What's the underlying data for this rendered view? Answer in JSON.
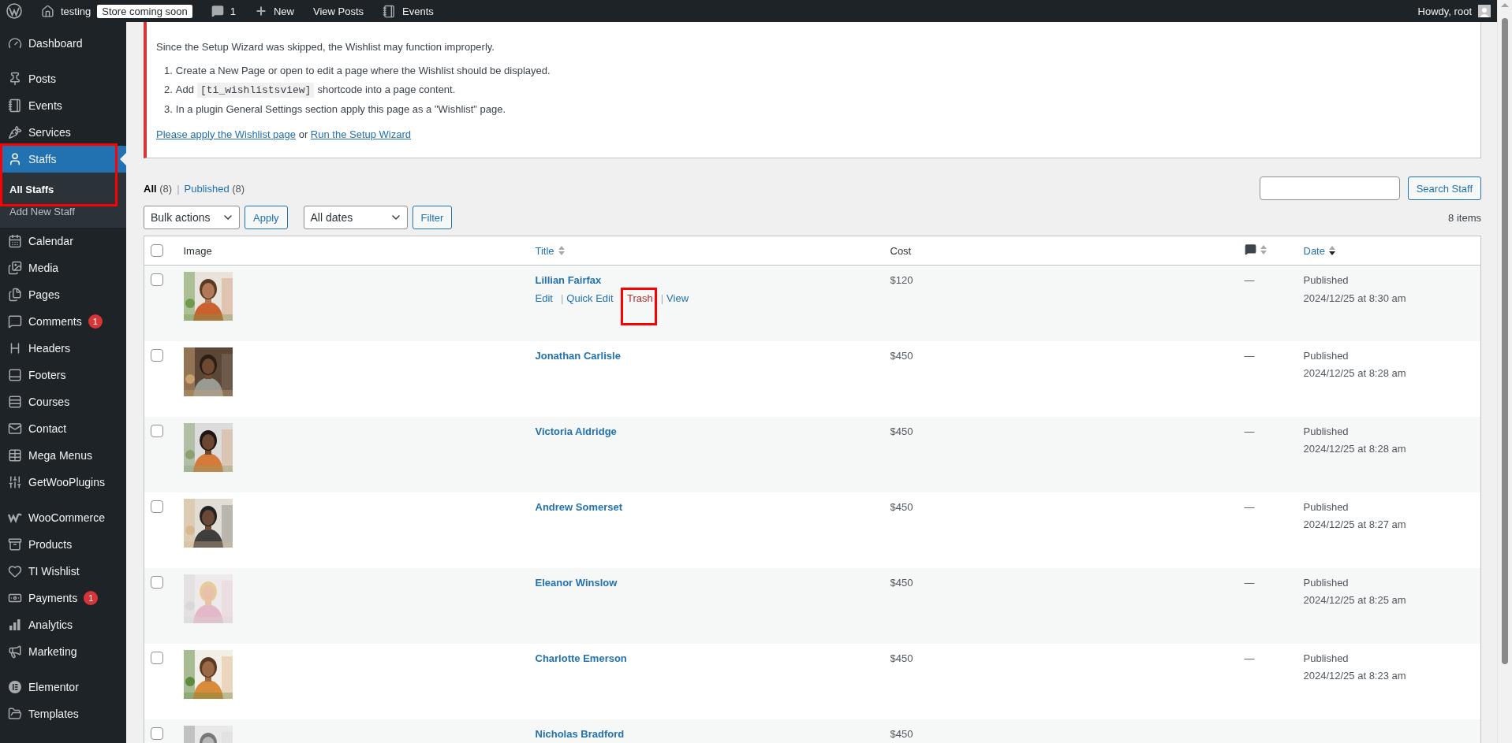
{
  "admin_bar": {
    "site": "testing",
    "badge": "Store coming soon",
    "comments_count": "1",
    "new": "New",
    "view_posts": "View Posts",
    "events": "Events",
    "greeting": "Howdy, root"
  },
  "sidebar": {
    "groups": [
      [
        {
          "label": "Dashboard",
          "selected": false,
          "highlighted": false
        }
      ],
      [
        {
          "label": "Posts",
          "selected": false,
          "highlighted": false
        },
        {
          "label": "Events",
          "selected": false,
          "highlighted": false
        },
        {
          "label": "Services",
          "selected": false,
          "highlighted": false
        },
        {
          "label": "Staffs",
          "selected": true,
          "highlighted": true,
          "children": [
            {
              "label": "All Staffs",
              "selected": true
            },
            {
              "label": "Add New Staff",
              "selected": false
            }
          ]
        },
        {
          "label": "Calendar",
          "selected": false,
          "highlighted": false
        },
        {
          "label": "Media",
          "selected": false,
          "highlighted": false
        },
        {
          "label": "Pages",
          "selected": false,
          "highlighted": false
        },
        {
          "label": "Comments",
          "selected": false,
          "highlighted": false,
          "badge": "1"
        },
        {
          "label": "Headers",
          "selected": false,
          "highlighted": false
        },
        {
          "label": "Footers",
          "selected": false,
          "highlighted": false
        },
        {
          "label": "Courses",
          "selected": false,
          "highlighted": false
        },
        {
          "label": "Contact",
          "selected": false,
          "highlighted": false
        },
        {
          "label": "Mega Menus",
          "selected": false,
          "highlighted": false
        },
        {
          "label": "GetWooPlugins",
          "selected": false,
          "highlighted": false
        }
      ],
      [
        {
          "label": "WooCommerce",
          "selected": false,
          "highlighted": false
        },
        {
          "label": "Products",
          "selected": false,
          "highlighted": false
        },
        {
          "label": "TI Wishlist",
          "selected": false,
          "highlighted": false
        },
        {
          "label": "Payments",
          "selected": false,
          "highlighted": false,
          "badge": "1"
        },
        {
          "label": "Analytics",
          "selected": false,
          "highlighted": false
        },
        {
          "label": "Marketing",
          "selected": false,
          "highlighted": false
        }
      ],
      [
        {
          "label": "Elementor",
          "selected": false,
          "highlighted": false
        },
        {
          "label": "Templates",
          "selected": false,
          "highlighted": false
        }
      ]
    ]
  },
  "notice": {
    "intro": "Since the Setup Wizard was skipped, the Wishlist may function improperly.",
    "steps": [
      {
        "number": "1.",
        "text": "Create a New Page or open to edit a page where the Wishlist should be displayed."
      },
      {
        "number": "2.",
        "text": "Add",
        "code": "[ti_wishlistsview]",
        "after": "shortcode into a page content."
      },
      {
        "number": "3.",
        "text": "In a plugin General Settings section apply this page as a \"Wishlist\" page."
      }
    ],
    "link_1": "Please apply the Wishlist page",
    "joiner": "or",
    "link_2": "Run the Setup Wizard"
  },
  "views": {
    "separator": "|",
    "items": [
      {
        "label": "All",
        "count": "(8)",
        "selected": true
      },
      {
        "label": "Published",
        "count": "(8)",
        "selected": false
      }
    ]
  },
  "search_button": "Search Staff",
  "bulk_select": "Bulk actions",
  "apply": "Apply",
  "dates_select": "All dates",
  "filter": "Filter",
  "items_count": "8 items",
  "columns": [
    {
      "kind": "text",
      "label": "Image"
    },
    {
      "kind": "sortable",
      "label": "Title",
      "sorted_desc": false
    },
    {
      "kind": "text",
      "label": "Cost"
    },
    {
      "kind": "comments",
      "sorted_desc": false
    },
    {
      "kind": "sortable",
      "label": "Date",
      "sorted_desc": true
    }
  ],
  "header_checked": false,
  "action_separator": "|",
  "rows": [
    {
      "checked": false,
      "photo": {
        "kind": "picture"
      },
      "title": "Lillian Fairfax",
      "cost": "$120",
      "comments": "—",
      "status": "Published",
      "date": "2024/12/25 at 8:30 am",
      "actions": [
        {
          "label": "Edit",
          "kind": "link",
          "highlighted": false
        },
        {
          "label": "Quick Edit",
          "kind": "link",
          "highlighted": false
        },
        {
          "label": "Trash",
          "kind": "delete",
          "highlighted": true
        },
        {
          "label": "View",
          "kind": "link",
          "highlighted": false
        }
      ]
    },
    {
      "checked": false,
      "photo": {
        "kind": "picture"
      },
      "title": "Jonathan Carlisle",
      "cost": "$450",
      "comments": "—",
      "status": "Published",
      "date": "2024/12/25 at 8:28 am"
    },
    {
      "checked": false,
      "photo": {
        "kind": "picture"
      },
      "title": "Victoria Aldridge",
      "cost": "$450",
      "comments": "—",
      "status": "Published",
      "date": "2024/12/25 at 8:28 am"
    },
    {
      "checked": false,
      "photo": {
        "kind": "picture"
      },
      "title": "Andrew Somerset",
      "cost": "$450",
      "comments": "—",
      "status": "Published",
      "date": "2024/12/25 at 8:27 am"
    },
    {
      "checked": false,
      "photo": {
        "kind": "picture"
      },
      "title": "Eleanor Winslow",
      "cost": "$450",
      "comments": "—",
      "status": "Published",
      "date": "2024/12/25 at 8:25 am"
    },
    {
      "checked": false,
      "photo": {
        "kind": "picture"
      },
      "title": "Charlotte Emerson",
      "cost": "$450",
      "comments": "—",
      "status": "Published",
      "date": "2024/12/25 at 8:23 am"
    },
    {
      "checked": false,
      "photo": {
        "kind": "picture"
      },
      "title": "Nicholas Bradford",
      "cost": "$450"
    }
  ]
}
